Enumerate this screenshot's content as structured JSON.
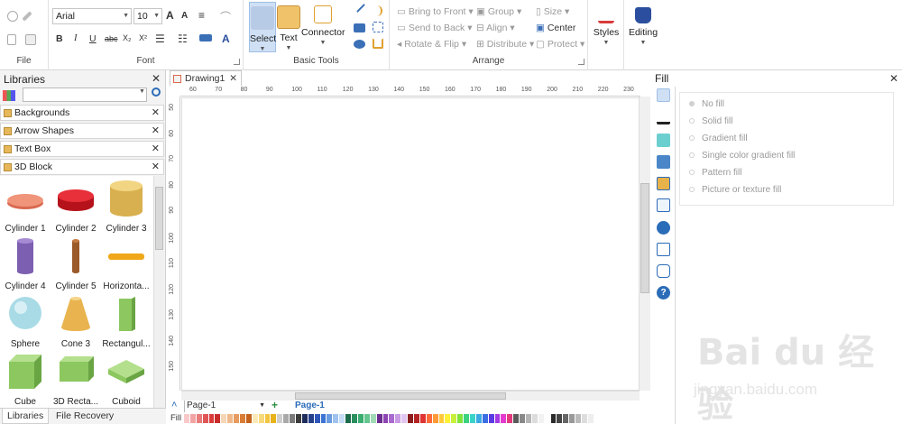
{
  "ribbon": {
    "font_group": {
      "label": "Font",
      "font_family": "Arial",
      "font_size": "10",
      "buttons": [
        "B",
        "I",
        "U",
        "abc",
        "X₂",
        "X²"
      ]
    },
    "file_group": {
      "label": "File"
    },
    "basic_tools": {
      "label": "Basic Tools",
      "select": "Select",
      "text": "Text",
      "connector": "Connector"
    },
    "arrange": {
      "label": "Arrange",
      "bring_to_front": "Bring to Front",
      "send_to_back": "Send to Back",
      "rotate_flip": "Rotate & Flip",
      "group": "Group",
      "align": "Align",
      "distribute": "Distribute",
      "size": "Size",
      "center": "Center",
      "protect": "Protect"
    },
    "styles": "Styles",
    "editing": "Editing"
  },
  "libraries": {
    "title": "Libraries",
    "search_placeholder": "",
    "categories": [
      "Backgrounds",
      "Arrow Shapes",
      "Text Box",
      "3D Block"
    ],
    "shapes": [
      "Cylinder 1",
      "Cylinder 2",
      "Cylinder 3",
      "Cylinder 4",
      "Cylinder 5",
      "Horizonta...",
      "Sphere",
      "Cone 3",
      "Rectangul...",
      "Cube",
      "3D Recta...",
      "Cuboid"
    ],
    "tabs": [
      "Libraries",
      "File Recovery"
    ]
  },
  "document": {
    "tab": "Drawing1",
    "ruler_h": [
      "60",
      "70",
      "80",
      "90",
      "100",
      "110",
      "120",
      "130",
      "140",
      "150",
      "160",
      "170",
      "180",
      "190",
      "200",
      "210",
      "220",
      "230"
    ],
    "ruler_v": [
      "50",
      "60",
      "70",
      "80",
      "90",
      "100",
      "110",
      "120",
      "130",
      "140",
      "150"
    ],
    "page_select": "Page-1",
    "page_tab": "Page-1",
    "fill_label": "Fill"
  },
  "fill_panel": {
    "title": "Fill",
    "options": [
      "No fill",
      "Solid fill",
      "Gradient fill",
      "Single color gradient fill",
      "Pattern fill",
      "Picture or texture fill"
    ]
  },
  "watermark": {
    "brand": "Bai du 经验",
    "url": "jingyan.baidu.com"
  },
  "colors": {
    "accent": "#2b6cb8",
    "palette": [
      "#f8c9c9",
      "#f2a4a4",
      "#e97b7b",
      "#e05555",
      "#d93a3a",
      "#c92b2b",
      "#f6d6b6",
      "#f0b98a",
      "#e89b5e",
      "#d97c35",
      "#c5621c",
      "#fbe9b8",
      "#f7d97a",
      "#f2c640",
      "#e8b21a",
      "#cfcfcf",
      "#a9a9a9",
      "#7b7b7b",
      "#3c3c3c",
      "#1f2d5c",
      "#253f8a",
      "#2f56b8",
      "#3d74d4",
      "#6a9be0",
      "#9fc2ee",
      "#c6dcf6",
      "#1c6b4a",
      "#2a8f5f",
      "#3aad71",
      "#66c68f",
      "#a0dbb5",
      "#6b2d8f",
      "#8c45b3",
      "#a86ad0",
      "#c89be3",
      "#e1c6f2",
      "#8a1d1d",
      "#b32525",
      "#e03333",
      "#ff6a3a",
      "#ff9a3a",
      "#ffc93a",
      "#fff13a",
      "#c8f03a",
      "#7ee33a",
      "#3ad37e",
      "#3ad3c8",
      "#3aa9e3",
      "#3a6fe3",
      "#5a3ae3",
      "#a33ae3",
      "#e33ad0",
      "#e33a7e",
      "#5a5a5a",
      "#888888",
      "#b5b5b5",
      "#dcdcdc",
      "#f2f2f2",
      "#ffffff",
      "#2a2a2a",
      "#444444",
      "#666666",
      "#999999",
      "#bbbbbb",
      "#dddddd",
      "#eeeeee"
    ]
  }
}
